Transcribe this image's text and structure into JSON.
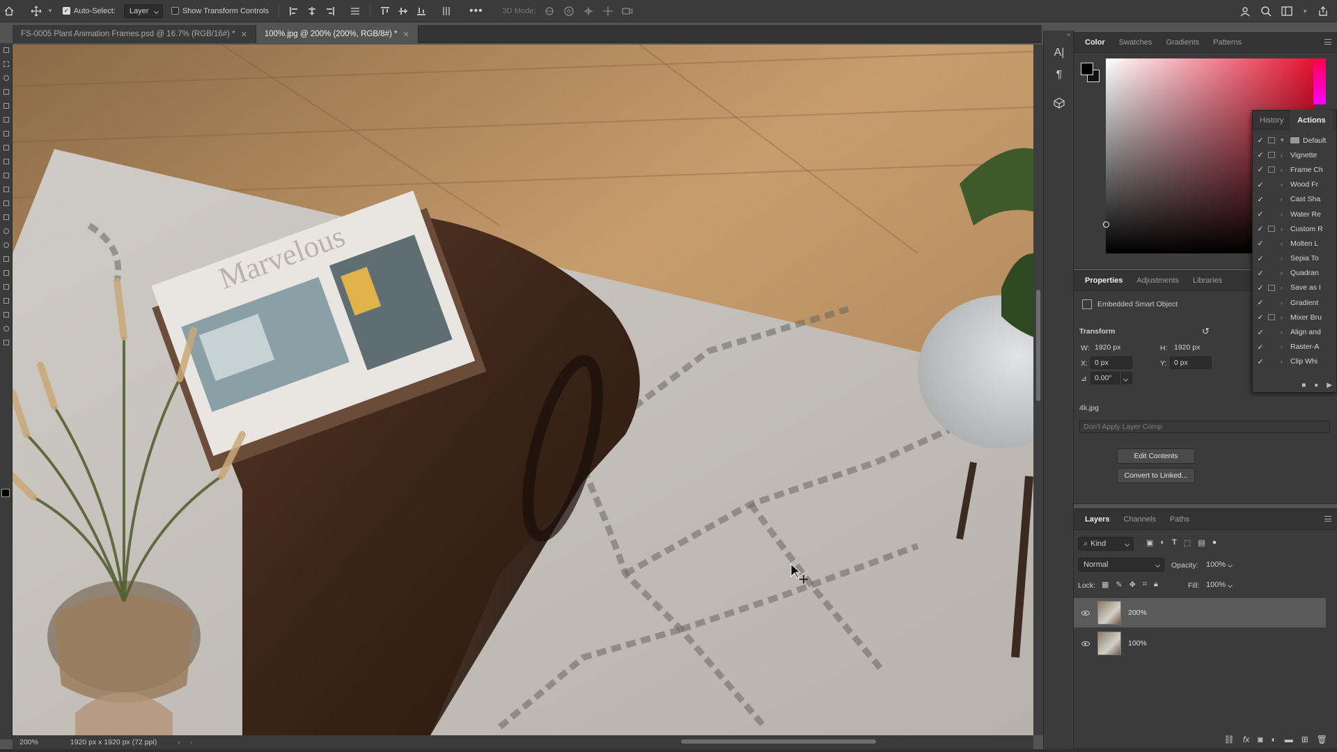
{
  "options_bar": {
    "auto_select_label": "Auto-Select:",
    "auto_select_target": "Layer",
    "show_transform_label": "Show Transform Controls",
    "mode_3d_label": "3D Mode:"
  },
  "tabs": [
    {
      "label": "FS-0005 Plant Animation Frames.psd @ 16.7% (RGB/16#) *",
      "active": false
    },
    {
      "label": "100%.jpg @ 200% (200%, RGB/8#) *",
      "active": true
    }
  ],
  "status_bar": {
    "zoom": "200%",
    "doc_info": "1920 px x 1920 px (72 ppi)"
  },
  "canvas_text": {
    "magazine_title": "Marvelous"
  },
  "color_panel": {
    "tabs": [
      "Color",
      "Swatches",
      "Gradients",
      "Patterns"
    ],
    "hue_color": "#e8112f"
  },
  "history_actions": {
    "tabs": [
      "History",
      "Actions"
    ],
    "items": [
      {
        "label": "Default",
        "folder": true,
        "dialog": true
      },
      {
        "label": "Vignette",
        "dialog": true
      },
      {
        "label": "Frame Ch",
        "dialog": true
      },
      {
        "label": "Wood Fr",
        "dialog": false
      },
      {
        "label": "Cast Sha",
        "dialog": false
      },
      {
        "label": "Water Re",
        "dialog": false
      },
      {
        "label": "Custom R",
        "dialog": true
      },
      {
        "label": "Molten L",
        "dialog": false
      },
      {
        "label": "Sepia To",
        "dialog": false
      },
      {
        "label": "Quadran",
        "dialog": false
      },
      {
        "label": "Save as I",
        "dialog": true
      },
      {
        "label": "Gradient",
        "dialog": false
      },
      {
        "label": "Mixer Bru",
        "dialog": true
      },
      {
        "label": "Align and",
        "dialog": false
      },
      {
        "label": "Raster-A",
        "dialog": false
      },
      {
        "label": "Clip Whi",
        "dialog": false
      }
    ]
  },
  "properties": {
    "tabs": [
      "Properties",
      "Adjustments",
      "Libraries"
    ],
    "type_label": "Embedded Smart Object",
    "transform_label": "Transform",
    "w_label": "W:",
    "w_value": "1920 px",
    "h_label": "H:",
    "h_value": "1920 px",
    "x_label": "X:",
    "x_value": "0 px",
    "y_label": "Y:",
    "y_value": "0 px",
    "angle_value": "0.00°",
    "source_file": "4k.jpg",
    "layer_comp_placeholder": "Don't Apply Layer Comp",
    "edit_contents_label": "Edit Contents",
    "convert_label": "Convert to Linked..."
  },
  "layers": {
    "tabs": [
      "Layers",
      "Channels",
      "Paths"
    ],
    "kind_label": "Kind",
    "blend_mode": "Normal",
    "opacity_label": "Opacity:",
    "opacity_value": "100%",
    "lock_label": "Lock:",
    "fill_label": "Fill:",
    "fill_value": "100%",
    "items": [
      {
        "name": "200%",
        "selected": true
      },
      {
        "name": "100%",
        "selected": false
      }
    ]
  }
}
